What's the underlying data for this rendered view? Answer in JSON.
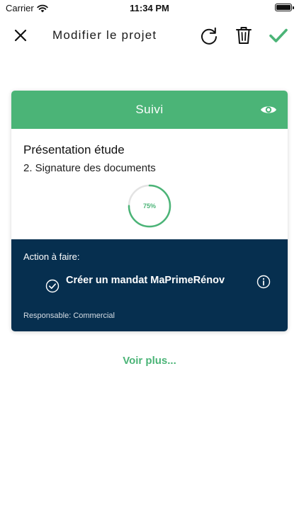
{
  "status_bar": {
    "carrier": "Carrier",
    "time": "11:34 PM"
  },
  "header": {
    "title": "Modifier le projet",
    "icons": [
      "close-icon",
      "refresh-icon",
      "trash-icon",
      "checkmark-icon"
    ]
  },
  "card": {
    "header_title": "Suivi",
    "title": "Présentation étude",
    "step": "2. Signature des documents",
    "progress": {
      "value": 0.75,
      "label": "75%"
    },
    "action": {
      "heading": "Action à faire:",
      "title": "Créer un mandat MaPrimeRénov",
      "owner": "Responsable: Commercial"
    }
  },
  "more_link": "Voir plus...",
  "colors": {
    "accent_green": "#4bb477",
    "navy": "#062f4f",
    "track_gray": "#e3e3e3"
  }
}
